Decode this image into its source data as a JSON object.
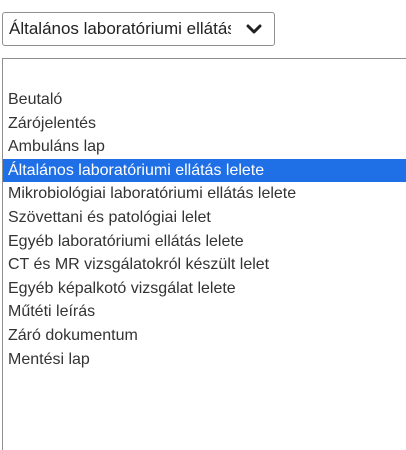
{
  "select": {
    "value": "Általános laboratóriumi ellátás lelete",
    "chevron_icon": "chevron-down-icon"
  },
  "dropdown": {
    "selected_index": 3,
    "selected_color": "#1f6fe6",
    "options": [
      "Beutaló",
      "Zárójelentés",
      "Ambuláns lap",
      "Általános laboratóriumi ellátás lelete",
      "Mikrobiológiai laboratóriumi ellátás lelete",
      "Szövettani és patológiai lelet",
      "Egyéb laboratóriumi ellátás lelete",
      "CT és MR vizsgálatokról készült lelet",
      "Egyéb képalkotó vizsgálat lelete",
      "Műtéti leírás",
      "Záró dokumentum",
      "Mentési lap"
    ]
  }
}
